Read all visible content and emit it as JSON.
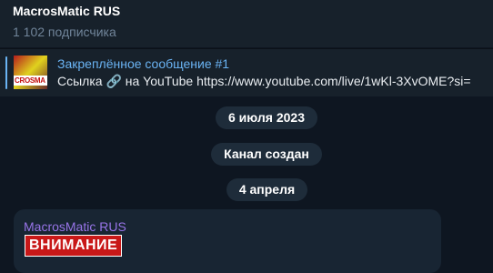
{
  "header": {
    "title": "MacrosMatic RUS",
    "subscribers": "1 102 подписчика"
  },
  "pinned": {
    "title": "Закреплённое сообщение #1",
    "text": "Ссылка 🔗 на YouTube  https://www.youtube.com/live/1wKl-3XvOME?si=",
    "thumbnail_text": "CROSMA"
  },
  "service": {
    "date1": "6 июля 2023",
    "created": "Канал создан",
    "date2": "4 апреля"
  },
  "message": {
    "author": "MacrosMatic RUS",
    "badge": "ВНИМАНИЕ"
  },
  "colors": {
    "accent": "#6ab3f3",
    "author": "#9774e7",
    "badge": "#c81818",
    "background": "#0e1621"
  }
}
